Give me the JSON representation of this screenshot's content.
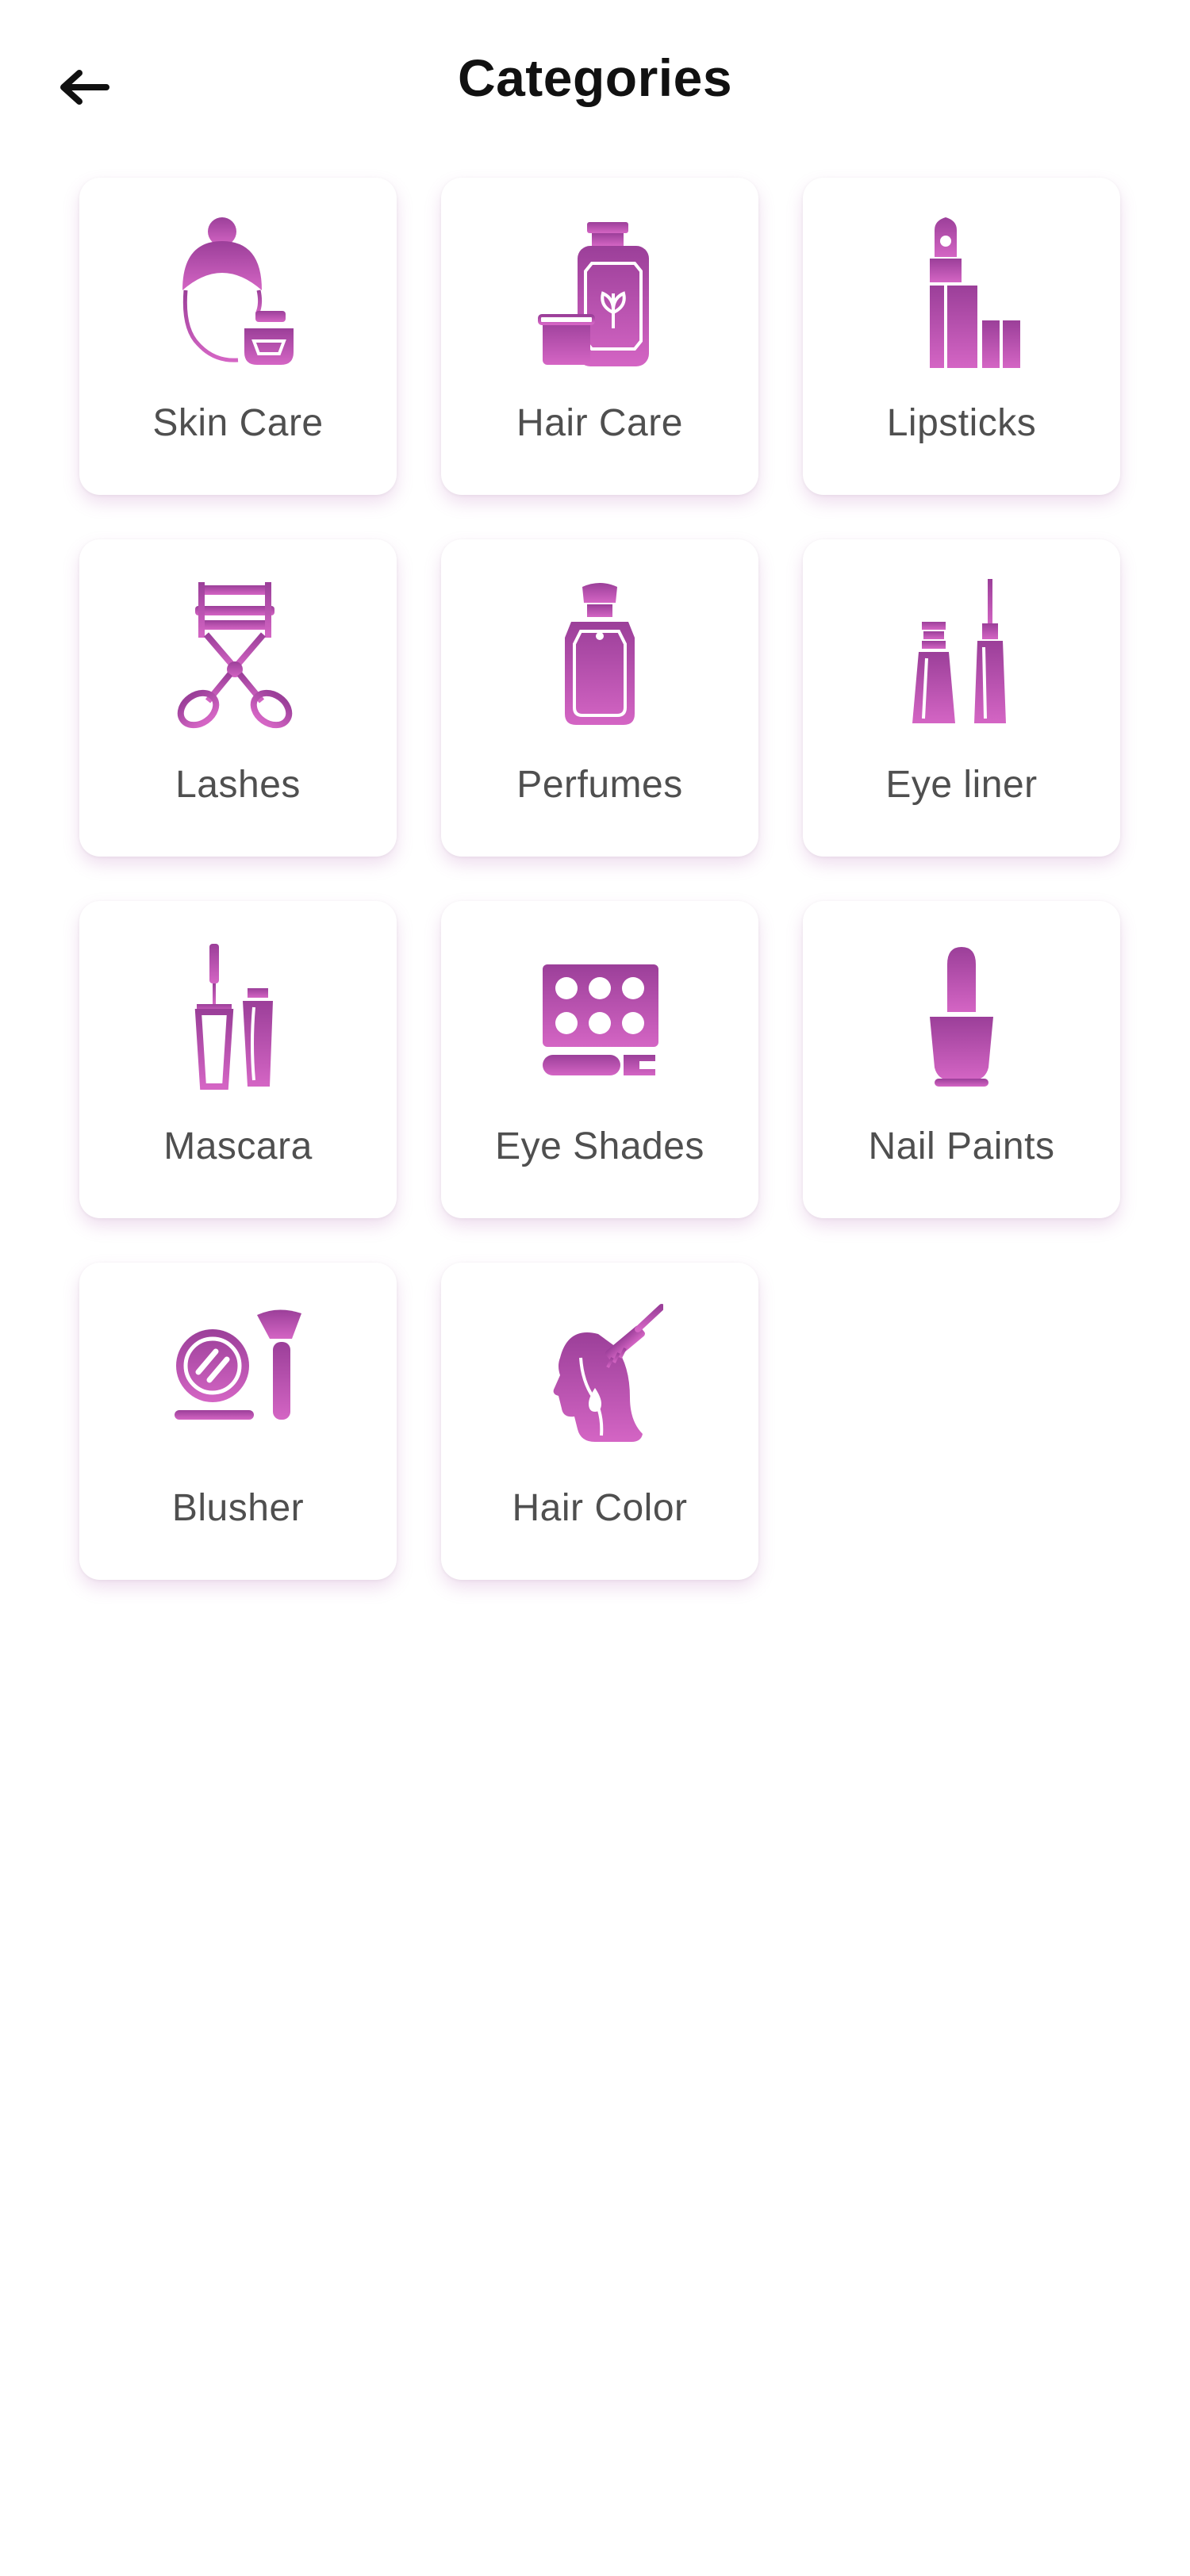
{
  "header": {
    "back_icon": "arrow-left-icon",
    "title": "Categories"
  },
  "colors": {
    "accent_dark": "#9b3f99",
    "accent_light": "#d465c4",
    "text": "#111111",
    "label": "#4f4f4f"
  },
  "categories": [
    {
      "label": "Skin Care",
      "icon": "skin-care-icon"
    },
    {
      "label": "Hair Care",
      "icon": "hair-care-icon"
    },
    {
      "label": "Lipsticks",
      "icon": "lipstick-icon"
    },
    {
      "label": "Lashes",
      "icon": "eyelash-curler-icon"
    },
    {
      "label": "Perfumes",
      "icon": "perfume-bottle-icon"
    },
    {
      "label": "Eye liner",
      "icon": "eye-liner-icon"
    },
    {
      "label": "Mascara",
      "icon": "mascara-icon"
    },
    {
      "label": "Eye Shades",
      "icon": "eyeshadow-palette-icon"
    },
    {
      "label": "Nail Paints",
      "icon": "nail-polish-icon"
    },
    {
      "label": "Blusher",
      "icon": "blusher-compact-icon"
    },
    {
      "label": "Hair Color",
      "icon": "hair-dye-icon"
    }
  ]
}
